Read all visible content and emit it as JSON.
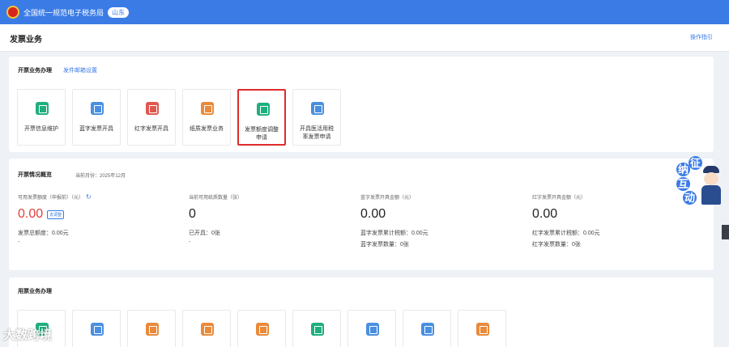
{
  "header": {
    "site_title": "全国统一规范电子税务局",
    "region": "山东"
  },
  "page": {
    "title": "发票业务",
    "help": "操作指引"
  },
  "colors": {
    "brand": "#3a7be6",
    "highlight": "#e02b2b"
  },
  "invoice_ops": {
    "title": "开票业务办理",
    "settings_link": "发件邮箱设置",
    "tiles": [
      {
        "label": "开票信息维护",
        "icon": "invoice-info-icon",
        "color": "#1fae7f"
      },
      {
        "label": "蓝字发票开具",
        "icon": "blue-invoice-icon",
        "color": "#4a8fe0"
      },
      {
        "label": "红字发票开具",
        "icon": "red-invoice-icon",
        "color": "#e0574f"
      },
      {
        "label": "纸质发票业务",
        "icon": "paper-invoice-icon",
        "color": "#ea8a3a"
      },
      {
        "label": "发票额度调整\n申请",
        "icon": "quota-adjust-icon",
        "color": "#1fae7f"
      },
      {
        "label": "开具医活用税\n率发票申请",
        "icon": "tax-rate-apply-icon",
        "color": "#4a8fe0"
      }
    ]
  },
  "overview": {
    "title": "开票情况概览",
    "month": "当前月份：2025年12月",
    "stats": [
      {
        "label": "可用发票额度（申报前）（元）",
        "value": "0.00",
        "badge": "去调整",
        "line1": "发票总额度：0.00元",
        "dash": "-"
      },
      {
        "label": "当前可用纸质数量（张）",
        "value": "0",
        "line1": "已开具：0张",
        "dash": "-"
      },
      {
        "label": "蓝字发票开具金额（元）",
        "value": "0.00",
        "line1": "蓝字发票累计税额：0.00元",
        "line2": "蓝字发票数量：0张"
      },
      {
        "label": "红字发票开具金额（元）",
        "value": "0.00",
        "line1": "红字发票累计税额：0.00元",
        "line2": "红字发票数量：0张"
      }
    ]
  },
  "usage_ops": {
    "title": "用票业务办理",
    "tiles": [
      {
        "icon": "invoice-query-icon",
        "color": "#1fae7f"
      },
      {
        "icon": "invoice-download-icon",
        "color": "#4a8fe0"
      },
      {
        "icon": "invoice-confirm-icon",
        "color": "#ea8a3a"
      },
      {
        "icon": "invoice-deduct-icon",
        "color": "#ea8a3a"
      },
      {
        "icon": "invoice-export-icon",
        "color": "#ea8a3a"
      },
      {
        "icon": "invoice-print-icon",
        "color": "#1fae7f"
      },
      {
        "icon": "invoice-mail-icon",
        "color": "#4a8fe0"
      },
      {
        "icon": "invoice-grid-icon",
        "color": "#4a8fe0"
      },
      {
        "icon": "invoice-image-icon",
        "color": "#ea8a3a"
      }
    ]
  },
  "side_widget": {
    "chars": [
      "纳",
      "征",
      "互",
      "动"
    ]
  },
  "watermark": "大数跨境"
}
